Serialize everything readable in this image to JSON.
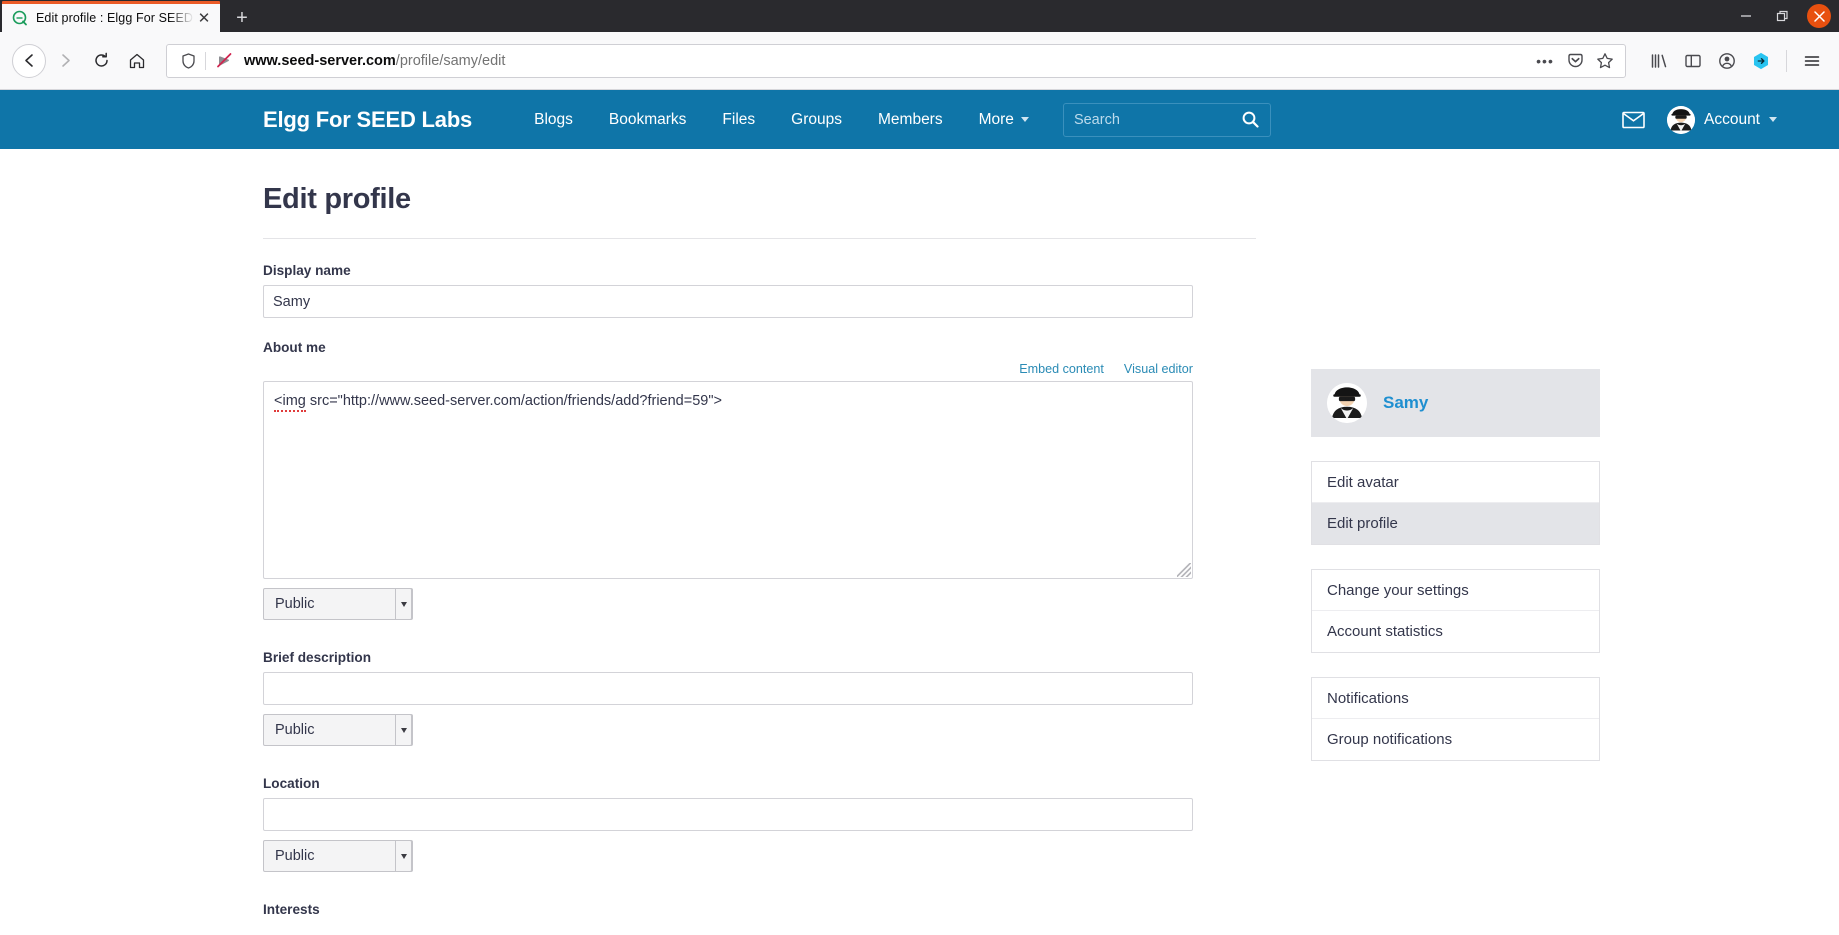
{
  "browser": {
    "tab": {
      "title": "Edit profile : Elgg For SEED Labs",
      "favicon": "elgg-favicon",
      "close_label": "✕"
    },
    "new_tab_label": "+",
    "window_controls": {
      "minimize": "─",
      "maximize": "❐",
      "close": "✕"
    },
    "nav": {
      "back": "←",
      "forward": "→",
      "reload": "↻",
      "home": "⌂"
    },
    "url": {
      "domain": "www.seed-server.com",
      "path": "/profile/samy/edit",
      "full": "www.seed-server.com/profile/samy/edit"
    },
    "url_icons": {
      "shield": "shield-icon",
      "insecure": "insecure-connection-icon",
      "more": "•••",
      "pocket": "pocket-icon",
      "bookmark": "star-icon"
    },
    "toolbar_icons": [
      "library-icon",
      "sidebar-icon",
      "account-icon",
      "extension-icon",
      "menu-icon"
    ]
  },
  "site": {
    "brand": "Elgg For SEED Labs",
    "nav": [
      {
        "label": "Blogs",
        "has_caret": false
      },
      {
        "label": "Bookmarks",
        "has_caret": false
      },
      {
        "label": "Files",
        "has_caret": false
      },
      {
        "label": "Groups",
        "has_caret": false
      },
      {
        "label": "Members",
        "has_caret": false
      },
      {
        "label": "More",
        "has_caret": true
      }
    ],
    "search": {
      "placeholder": "Search",
      "value": ""
    },
    "account": {
      "label": "Account",
      "avatar": "spy-avatar"
    },
    "messages_icon": "envelope-icon",
    "accent_color": "#0f75a8"
  },
  "main": {
    "title": "Edit profile",
    "editor_links": {
      "embed": "Embed content",
      "visual": "Visual editor"
    },
    "fields": [
      {
        "label": "Display name",
        "type": "text",
        "value": "Samy",
        "access": null
      },
      {
        "label": "About me",
        "type": "textarea",
        "value": "<img src=\"http://www.seed-server.com/action/friends/add?friend=59\">",
        "spell_word": "img",
        "access": "Public"
      },
      {
        "label": "Brief description",
        "type": "text",
        "value": "",
        "access": "Public"
      },
      {
        "label": "Location",
        "type": "text",
        "value": "",
        "access": "Public"
      },
      {
        "label": "Interests",
        "type": "text",
        "value": "",
        "access": null
      }
    ]
  },
  "sidebar": {
    "profile": {
      "name": "Samy",
      "avatar": "spy-avatar"
    },
    "groups": [
      {
        "items": [
          {
            "label": "Edit avatar",
            "active": false
          },
          {
            "label": "Edit profile",
            "active": true
          }
        ]
      },
      {
        "items": [
          {
            "label": "Change your settings",
            "active": false
          },
          {
            "label": "Account statistics",
            "active": false
          }
        ]
      },
      {
        "items": [
          {
            "label": "Notifications",
            "active": false
          },
          {
            "label": "Group notifications",
            "active": false
          }
        ]
      }
    ]
  }
}
